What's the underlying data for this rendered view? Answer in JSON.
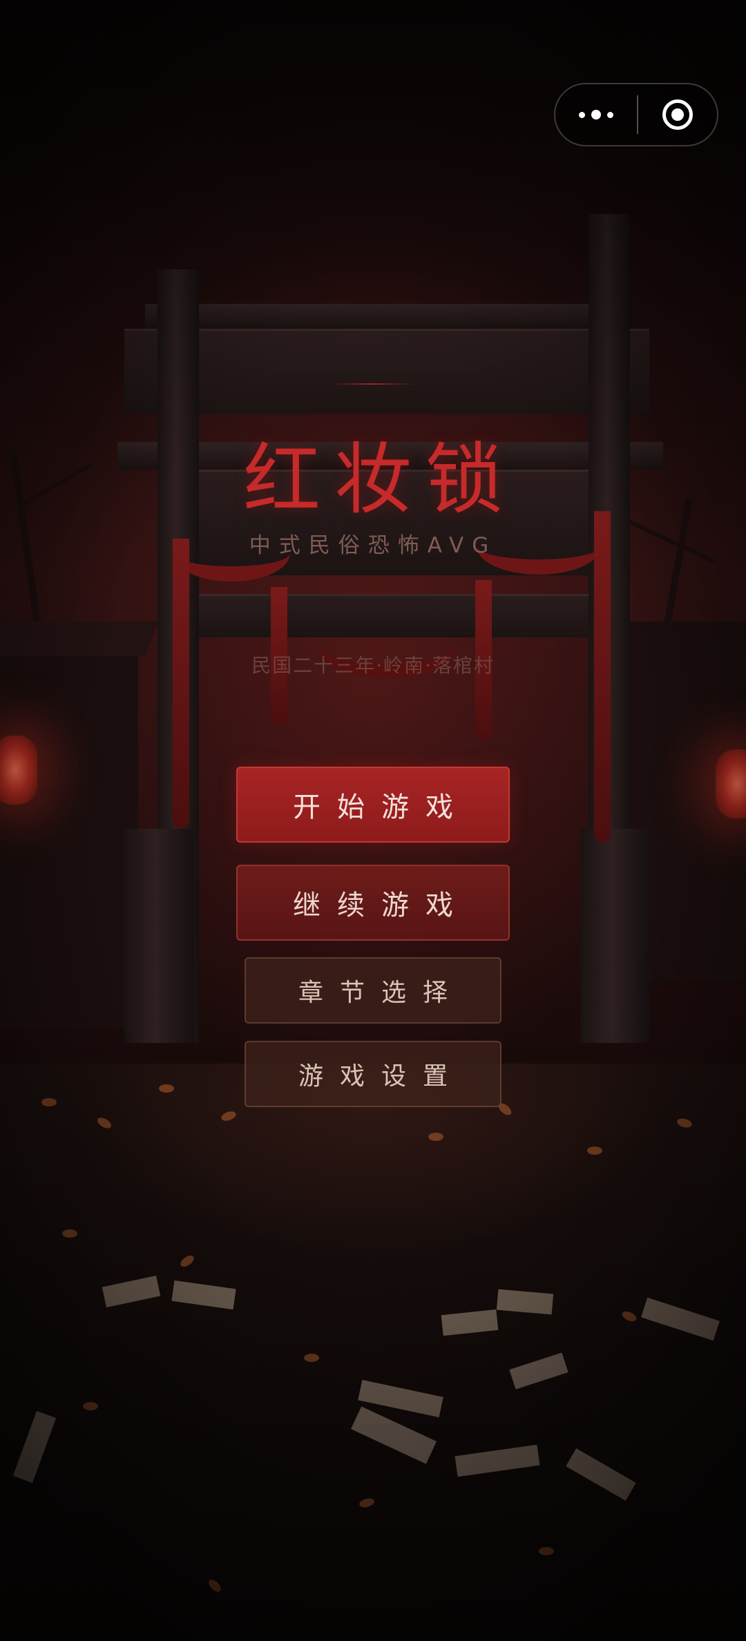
{
  "game": {
    "title": "红妆锁",
    "subtitle": "中式民俗恐怖AVG",
    "tagline": "民国二十三年·岭南·落棺村"
  },
  "menu": {
    "start_label": "开始游戏",
    "continue_label": "继续游戏",
    "chapter_label": "章节选择",
    "settings_label": "游戏设置"
  },
  "capsule": {
    "more_icon": "more-dots-icon",
    "close_icon": "target-circle-icon"
  },
  "colors": {
    "title": "#c62a2a",
    "primary_button": "#a82424",
    "background": "#1c0b0b"
  }
}
